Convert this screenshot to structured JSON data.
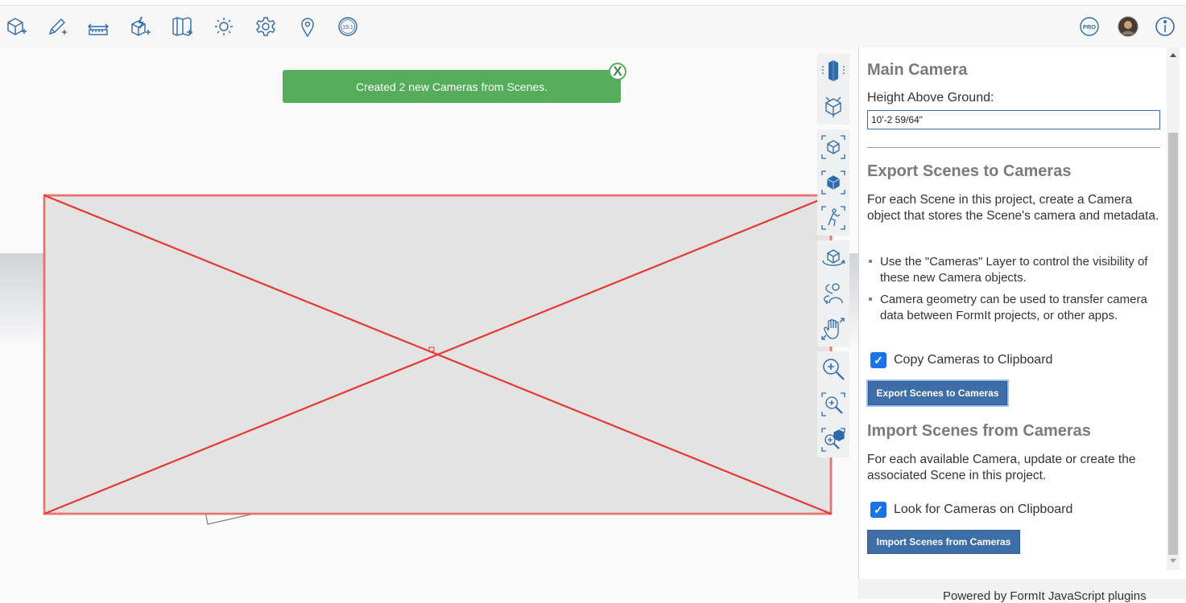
{
  "toolbar": {
    "left_icons": [
      "object-tool-icon",
      "sketch-tool-icon",
      "measure-tool-icon",
      "plugin-manager-icon",
      "scene-tool-icon",
      "sun-shadow-icon",
      "settings-gear-icon",
      "location-pin-icon",
      "version-badge-icon"
    ],
    "version_badge": "19.1",
    "pro_badge": "PRO"
  },
  "notification": {
    "message": "Created 2 new Cameras from Scenes.",
    "close_glyph": "X",
    "color": "#55ad5b"
  },
  "nav_tools": {
    "groups": [
      [
        "perspective-camera-icon",
        "view-cube-icon"
      ],
      [
        "zoom-extents-icon",
        "zoom-selected-icon",
        "walkthrough-icon"
      ],
      [
        "orbit-icon",
        "look-around-icon",
        "pan-icon"
      ],
      [
        "zoom-icon",
        "zoom-window-icon",
        "zoom-fit-icon"
      ]
    ]
  },
  "panel": {
    "main_camera_title": "Main Camera",
    "height_label": "Height Above Ground:",
    "height_value": "10'-2 59/64\"",
    "export_title": "Export Scenes to Cameras",
    "export_description": "For each Scene in this project, create a Camera object that stores the Scene's camera and metadata.",
    "export_bullets": [
      "Use the \"Cameras\" Layer to control the visibility of these new Camera objects.",
      "Camera geometry can be used to transfer camera data between FormIt projects, or other apps."
    ],
    "copy_checkbox_label": "Copy Cameras to Clipboard",
    "copy_checked": true,
    "export_button": "Export Scenes to Cameras",
    "import_title": "Import Scenes from Cameras",
    "import_description": "For each available Camera, update or create the associated Scene in this project.",
    "look_checkbox_label": "Look for Cameras on Clipboard",
    "look_checked": true,
    "import_button": "Import Scenes from Cameras",
    "footer": "Powered by FormIt JavaScript plugins"
  },
  "colors": {
    "accent": "#3e6ea8",
    "checkbox": "#1a73e8",
    "selection": "#e53935"
  }
}
